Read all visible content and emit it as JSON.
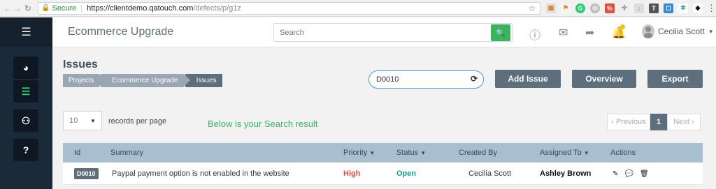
{
  "browser": {
    "secure_label": "Secure",
    "url_host": "https://clientdemo.qatouch.com",
    "url_path": "/defects/p/g1z"
  },
  "header": {
    "project_title": "Ecommerce Upgrade",
    "search_placeholder": "Search",
    "user_name": "Cecilia Scott"
  },
  "page": {
    "title": "Issues",
    "breadcrumb": [
      "Projects",
      "Ecommerce Upgrade",
      "Issues"
    ],
    "filter_value": "D0010",
    "buttons": {
      "add_issue": "Add Issue",
      "overview": "Overview",
      "export": "Export"
    },
    "per_page_value": "10",
    "per_page_label": "records per page",
    "search_result_msg": "Below is your Search result",
    "pager": {
      "previous": "‹  Previous",
      "current": "1",
      "next": "Next  ›"
    }
  },
  "table": {
    "headers": {
      "id": "Id",
      "summary": "Summary",
      "priority": "Priority",
      "status": "Status",
      "created_by": "Created By",
      "assigned_to": "Assigned To",
      "actions": "Actions"
    },
    "rows": [
      {
        "id": "D0010",
        "summary": "Paypal payment option is not enabled in the website",
        "priority": "High",
        "status": "Open",
        "created_by": "Cecilia Scott",
        "assigned_to": "Ashley Brown"
      }
    ]
  },
  "colors": {
    "sidebar": "#1b2a38",
    "accent_green": "#38b55d",
    "button_slate": "#5d6e7d",
    "table_header": "#a8bfd0",
    "priority_high": "#e74c3c",
    "status_open": "#16a085"
  }
}
